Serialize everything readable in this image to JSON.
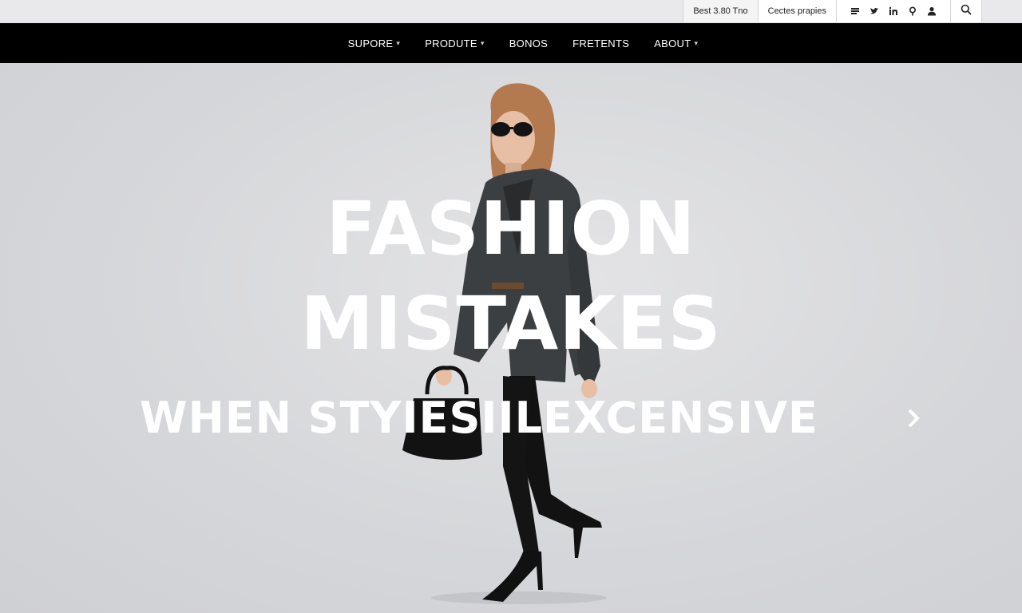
{
  "utility": {
    "item1": "Best 3.80 Tno",
    "item2": "Cectes prapies",
    "icons": [
      "bag-icon",
      "twitter-icon",
      "linkedin-icon",
      "location-pin-icon",
      "user-icon"
    ],
    "search_icon": "search-icon"
  },
  "nav": {
    "items": [
      {
        "label": "SUPORE",
        "dropdown": true
      },
      {
        "label": "PRODUTE",
        "dropdown": true
      },
      {
        "label": "BONOS",
        "dropdown": false
      },
      {
        "label": "FRETENTS",
        "dropdown": false
      },
      {
        "label": "ABOUT",
        "dropdown": true
      }
    ]
  },
  "hero": {
    "line1": "FASHION",
    "line2": "MISTAKES",
    "line3": "WHEN STYIESIILEXCENSIVE",
    "next_icon": "chevron-right-icon"
  },
  "colors": {
    "nav_bg": "#000000",
    "hero_bg": "#d9dadc",
    "headline": "#ffffff"
  }
}
